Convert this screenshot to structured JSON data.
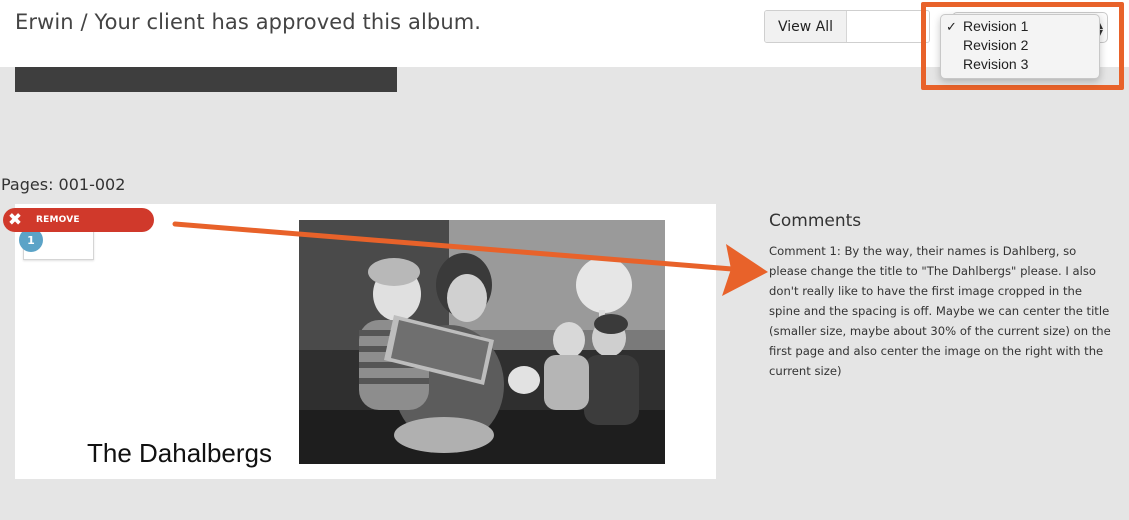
{
  "header": {
    "title": "Erwin / Your client has approved this album.",
    "view_all_label": "View All"
  },
  "revision_dropdown": {
    "options": [
      "Revision 1",
      "Revision 2",
      "Revision 3"
    ],
    "selected": "Revision 1",
    "check_glyph": "✓"
  },
  "annotation": {
    "highlight_color": "#e8622a",
    "arrow_color": "#e8622a"
  },
  "spread": {
    "pages_label": "Pages: 001-002",
    "remove_label": "REMOVE",
    "thumb_number": "1",
    "album_title": "The Dahalbergs",
    "photo": "black-and-white family photo"
  },
  "comments": {
    "heading": "Comments",
    "text": "Comment 1: By the way, their names is Dahlberg, so please change the title to \"The Dahlbergs\" please. I also don't really like to have the first image cropped in the spine and the spacing is off. Maybe we can center the title (smaller size, maybe about 30% of the current size) on the first page and also center the image on the right with the current size)"
  },
  "colors": {
    "remove": "#d0392b",
    "badge": "#5ba3c7",
    "background": "#e5e5e5"
  },
  "icons": {
    "remove": "close-icon",
    "select": "select-arrows-icon"
  }
}
